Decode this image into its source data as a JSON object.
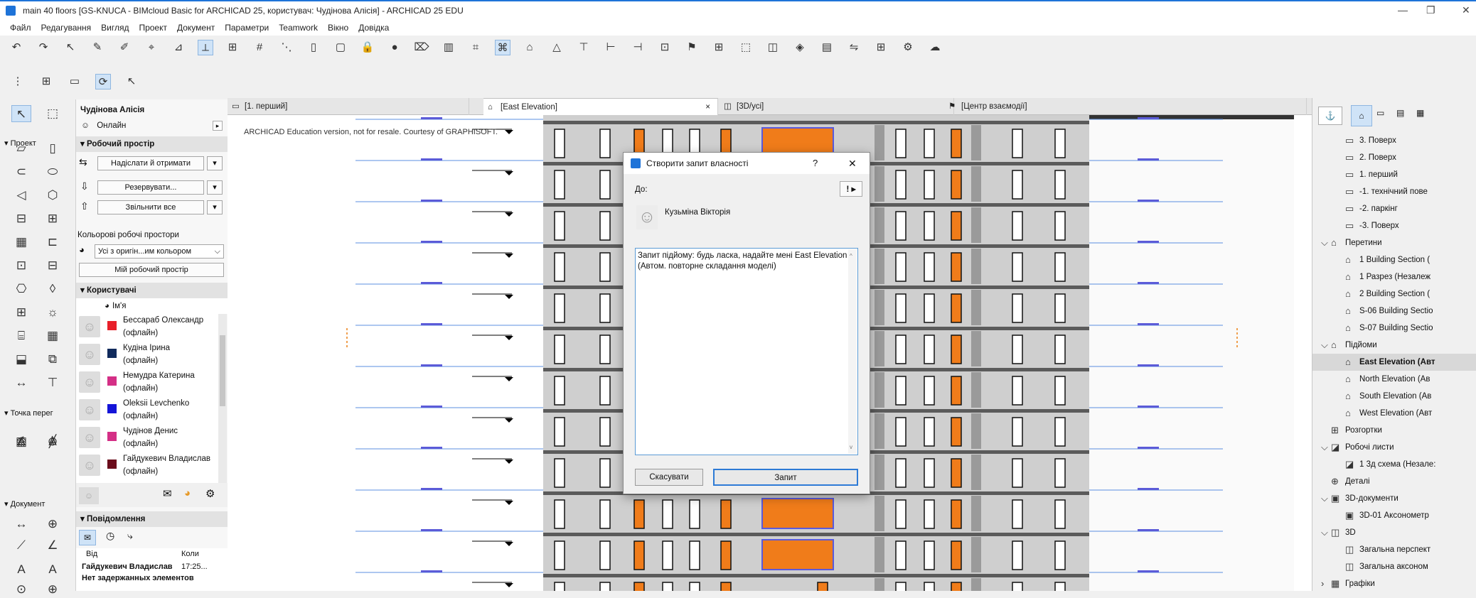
{
  "window": {
    "title": "main 40 floors [GS-KNUCA - BIMcloud Basic for ARCHICAD 25, користувач: Чудінова Аліcія] - ARCHICAD 25 EDU"
  },
  "menu": [
    "Файл",
    "Редагування",
    "Вигляд",
    "Проект",
    "Документ",
    "Параметри",
    "Teamwork",
    "Вікно",
    "Довідка"
  ],
  "toolbox": {
    "sections": {
      "project": "Проект",
      "viewpoint": "Точка перег",
      "document": "Документ"
    }
  },
  "team": {
    "user": "Чудінова Аліcія",
    "status": "Онлайн",
    "workspace_head": "Робочий простір",
    "send_receive": "Надіслати й отримати",
    "reserve": "Резервувати...",
    "release_all": "Звільнити все",
    "color_ws": "Кольорові робочі простори",
    "color_select": "Усі з оригін...им кольором",
    "my_ws": "Мій робочий простір",
    "users_head": "Користувачі",
    "name_col": "Ім'я",
    "users": [
      {
        "name": "Бессараб Олександр",
        "status": "(офлайн)",
        "color": "#e8202a"
      },
      {
        "name": "Кудіна Ірина",
        "status": "(офлайн)",
        "color": "#102a5c"
      },
      {
        "name": "Немудра Катерина",
        "status": "(офлайн)",
        "color": "#d42f86"
      },
      {
        "name": "Oleksii Levchenko",
        "status": "(офлайн)",
        "color": "#1414d8"
      },
      {
        "name": "Чудінов Денис",
        "status": "(офлайн)",
        "color": "#d42f86"
      },
      {
        "name": "Гайдукевич Владислав",
        "status": "(офлайн)",
        "color": "#6b0c1c"
      }
    ],
    "messages_head": "Повідомлення",
    "from_label": "Від",
    "when_label": "Коли",
    "msg_sender": "Гайдукевич Владислав",
    "msg_time": "17:25...",
    "msg_text": "Нет задержанных элементов"
  },
  "tabs": [
    {
      "label": "[1. перший]"
    },
    {
      "label": "[East Elevation]",
      "close": "×"
    },
    {
      "label": "[3D/усі]"
    },
    {
      "label": "[Центр взаємодії]"
    }
  ],
  "canvas": {
    "watermark": "ARCHICAD Education version, not for resale. Courtesy of GRAPHISOFT."
  },
  "navigator": [
    {
      "label": "3. Поверх",
      "level": 2,
      "icon": "storey"
    },
    {
      "label": "2. Поверх",
      "level": 2,
      "icon": "storey"
    },
    {
      "label": "1. перший",
      "level": 2,
      "icon": "storey"
    },
    {
      "label": "-1. технічний пове",
      "level": 2,
      "icon": "storey"
    },
    {
      "label": "-2. паркінг",
      "level": 2,
      "icon": "storey"
    },
    {
      "label": "-3. Поверх",
      "level": 2,
      "icon": "storey"
    },
    {
      "label": "Перетини",
      "level": 1,
      "icon": "section",
      "expanded": true
    },
    {
      "label": "1 Building Section (",
      "level": 2,
      "icon": "section"
    },
    {
      "label": "1 Разрез (Незалеж",
      "level": 2,
      "icon": "section"
    },
    {
      "label": "2 Building Section (",
      "level": 2,
      "icon": "section"
    },
    {
      "label": "S-06 Building Sectio",
      "level": 2,
      "icon": "section"
    },
    {
      "label": "S-07 Building Sectio",
      "level": 2,
      "icon": "section"
    },
    {
      "label": "Підйоми",
      "level": 1,
      "icon": "elevation",
      "expanded": true
    },
    {
      "label": "East Elevation (Авт",
      "level": 2,
      "icon": "elevation",
      "selected": true
    },
    {
      "label": "North Elevation (Ав",
      "level": 2,
      "icon": "elevation"
    },
    {
      "label": "South Elevation (Ав",
      "level": 2,
      "icon": "elevation"
    },
    {
      "label": "West Elevation (Авт",
      "level": 2,
      "icon": "elevation"
    },
    {
      "label": "Розгортки",
      "level": 1,
      "icon": "interior"
    },
    {
      "label": "Робочі листи",
      "level": 1,
      "icon": "worksheet",
      "expanded": true
    },
    {
      "label": "1 3д схема (Незале:",
      "level": 2,
      "icon": "worksheet"
    },
    {
      "label": "Деталі",
      "level": 1,
      "icon": "detail"
    },
    {
      "label": "3D-документи",
      "level": 1,
      "icon": "doc3d",
      "expanded": true
    },
    {
      "label": "3D-01 Аксонометр",
      "level": 2,
      "icon": "doc3d"
    },
    {
      "label": "3D",
      "level": 1,
      "icon": "cube",
      "expanded": true
    },
    {
      "label": "Загальна перспект",
      "level": 2,
      "icon": "cube"
    },
    {
      "label": "Загальна аксоном",
      "level": 2,
      "icon": "cube"
    },
    {
      "label": "Графіки",
      "level": 1,
      "icon": "schedule",
      "collapsed": true
    }
  ],
  "dialog": {
    "title": "Створити запит власності",
    "help": "?",
    "close": "✕",
    "to_label": "До:",
    "recipient": "Кузьміна Вікторія",
    "message": "Запит підйому: будь ласка, надайте мені East Elevation (Автом. повторне складання моделі)",
    "cancel": "Скасувати",
    "request": "Запит"
  },
  "colors": {
    "accent": "#1e73d8",
    "orange": "#f07c1a",
    "blue": "#5a5adc"
  }
}
